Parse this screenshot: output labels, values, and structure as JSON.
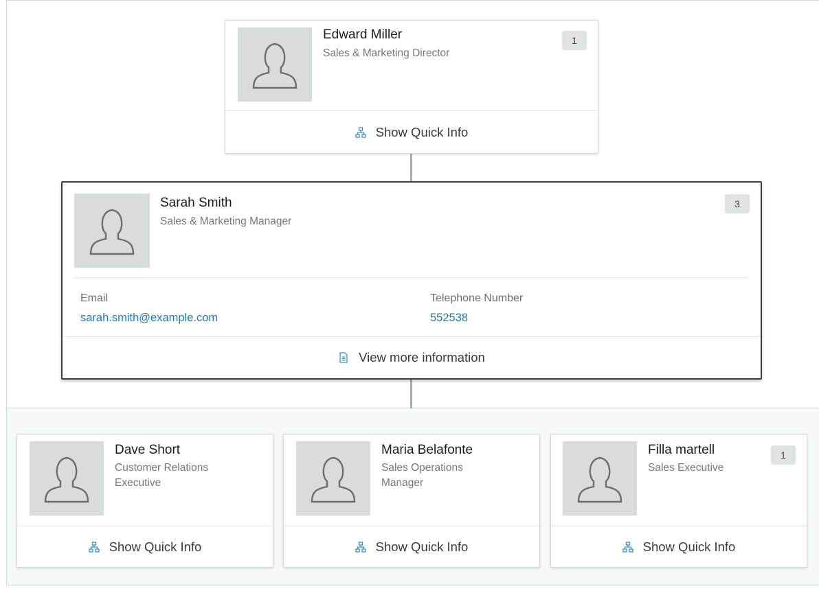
{
  "colors": {
    "accent_link": "#1b7bbf",
    "focus_border": "#3a4245",
    "band_bg": "#f5f9fa"
  },
  "icons": {
    "avatar": "person-silhouette-icon",
    "quick_info": "org-chart-icon",
    "more_info": "document-icon"
  },
  "top_card": {
    "name": "Edward Miller",
    "title": "Sales & Marketing Director",
    "count": "1",
    "action_label": "Show Quick Info"
  },
  "focused_card": {
    "name": "Sarah Smith",
    "title": "Sales & Marketing Manager",
    "count": "3",
    "email_label": "Email",
    "email_value": "sarah.smith@example.com",
    "phone_label": "Telephone Number",
    "phone_value": "552538",
    "action_label": "View more information"
  },
  "children": [
    {
      "name": "Dave Short",
      "title_line1": "Customer Relations",
      "title_line2": "Executive",
      "count": "",
      "action_label": "Show Quick Info"
    },
    {
      "name": "Maria Belafonte",
      "title_line1": "Sales Operations",
      "title_line2": "Manager",
      "count": "",
      "action_label": "Show Quick Info"
    },
    {
      "name": "Filla martell",
      "title_line1": "Sales Executive",
      "title_line2": "",
      "count": "1",
      "action_label": "Show Quick Info"
    }
  ]
}
